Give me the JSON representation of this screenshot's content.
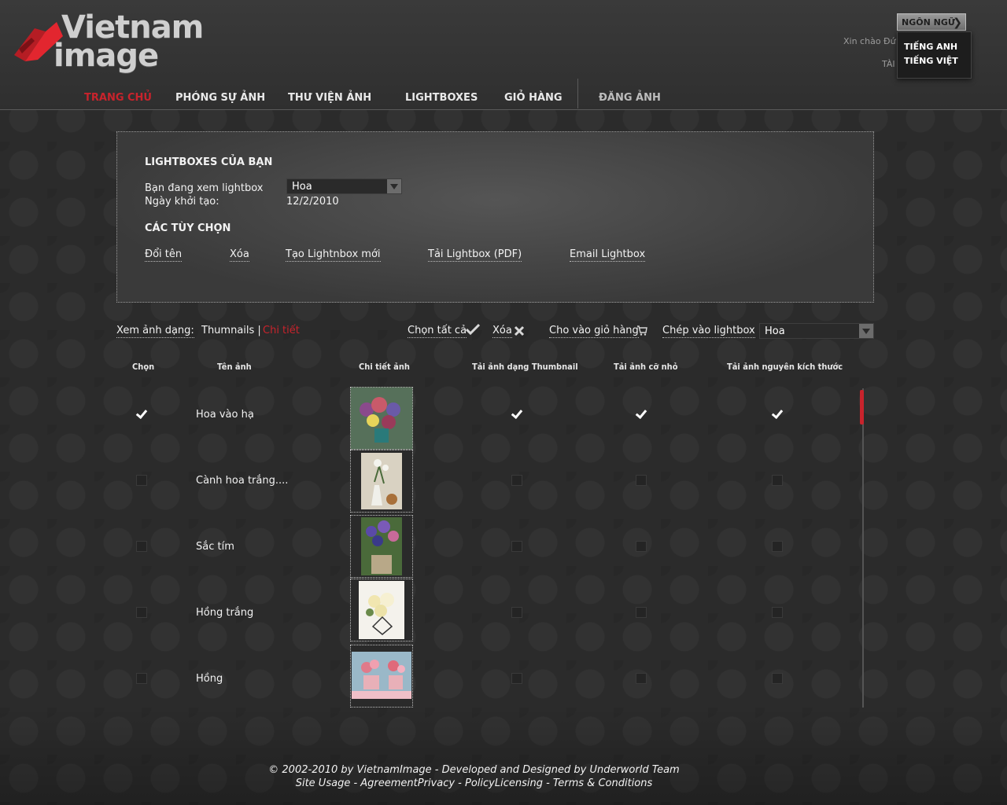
{
  "brand": {
    "line1": "Vietnam",
    "line2": "image"
  },
  "language": {
    "button": "NGÔN NGỮ",
    "options": [
      "TIẾNG ANH",
      "TIẾNG VIỆT"
    ]
  },
  "account": {
    "greeting": "Xin chào Đứ",
    "tai": "TÀI"
  },
  "nav": [
    "TRANG CHỦ",
    "PHÓNG SỰ ẢNH",
    "THƯ VIỆN ẢNH",
    "LIGHTBOXES",
    "GIỎ HÀNG",
    "ĐĂNG ẢNH"
  ],
  "panel": {
    "title": "LIGHTBOXES CỦA BẠN",
    "viewing_label": "Bạn đang xem lightbox",
    "viewing_value": "Hoa",
    "created_label": "Ngày khởi tạo:",
    "created_value": "12/2/2010",
    "options_title": "CÁC TÙY CHỌN",
    "actions": [
      "Đổi tên",
      "Xóa",
      "Tạo Lightnbox mới",
      "Tải Lightbox (PDF)",
      "Email Lightbox"
    ]
  },
  "toolbar": {
    "view_label": "Xem ảnh dạng:",
    "view_thumb": "Thumnails |",
    "view_detail": "Chi tiết",
    "select_all": "Chọn tất cả",
    "delete": "Xóa",
    "to_cart": "Cho vào giỏ hàng",
    "copy_to": "Chép vào lightbox",
    "target_lightbox": "Hoa"
  },
  "table": {
    "headers": [
      "Chọn",
      "Tên ảnh",
      "Chi tiết ảnh",
      "Tải ảnh dạng Thumbnail",
      "Tải ảnh cỡ nhỏ",
      "Tải ảnh nguyên kích thước"
    ],
    "rows": [
      {
        "name": "Hoa vào hạ",
        "select": true,
        "thumb": true,
        "small": true,
        "full": true
      },
      {
        "name": "Cành hoa trắng....",
        "select": false,
        "thumb": false,
        "small": false,
        "full": false
      },
      {
        "name": "Sắc tím",
        "select": false,
        "thumb": false,
        "small": false,
        "full": false
      },
      {
        "name": "Hồng trắng",
        "select": false,
        "thumb": false,
        "small": false,
        "full": false
      },
      {
        "name": "Hồng",
        "select": false,
        "thumb": false,
        "small": false,
        "full": false
      }
    ]
  },
  "footer": {
    "line1": "© 2002-2010 by VietnamImage - Developed and Designed by Underworld Team",
    "line2": "Site Usage - AgreementPrivacy  - PolicyLicensing - Terms & Conditions"
  },
  "colors": {
    "accent": "#c8232c",
    "background": "#2b2b2b"
  }
}
